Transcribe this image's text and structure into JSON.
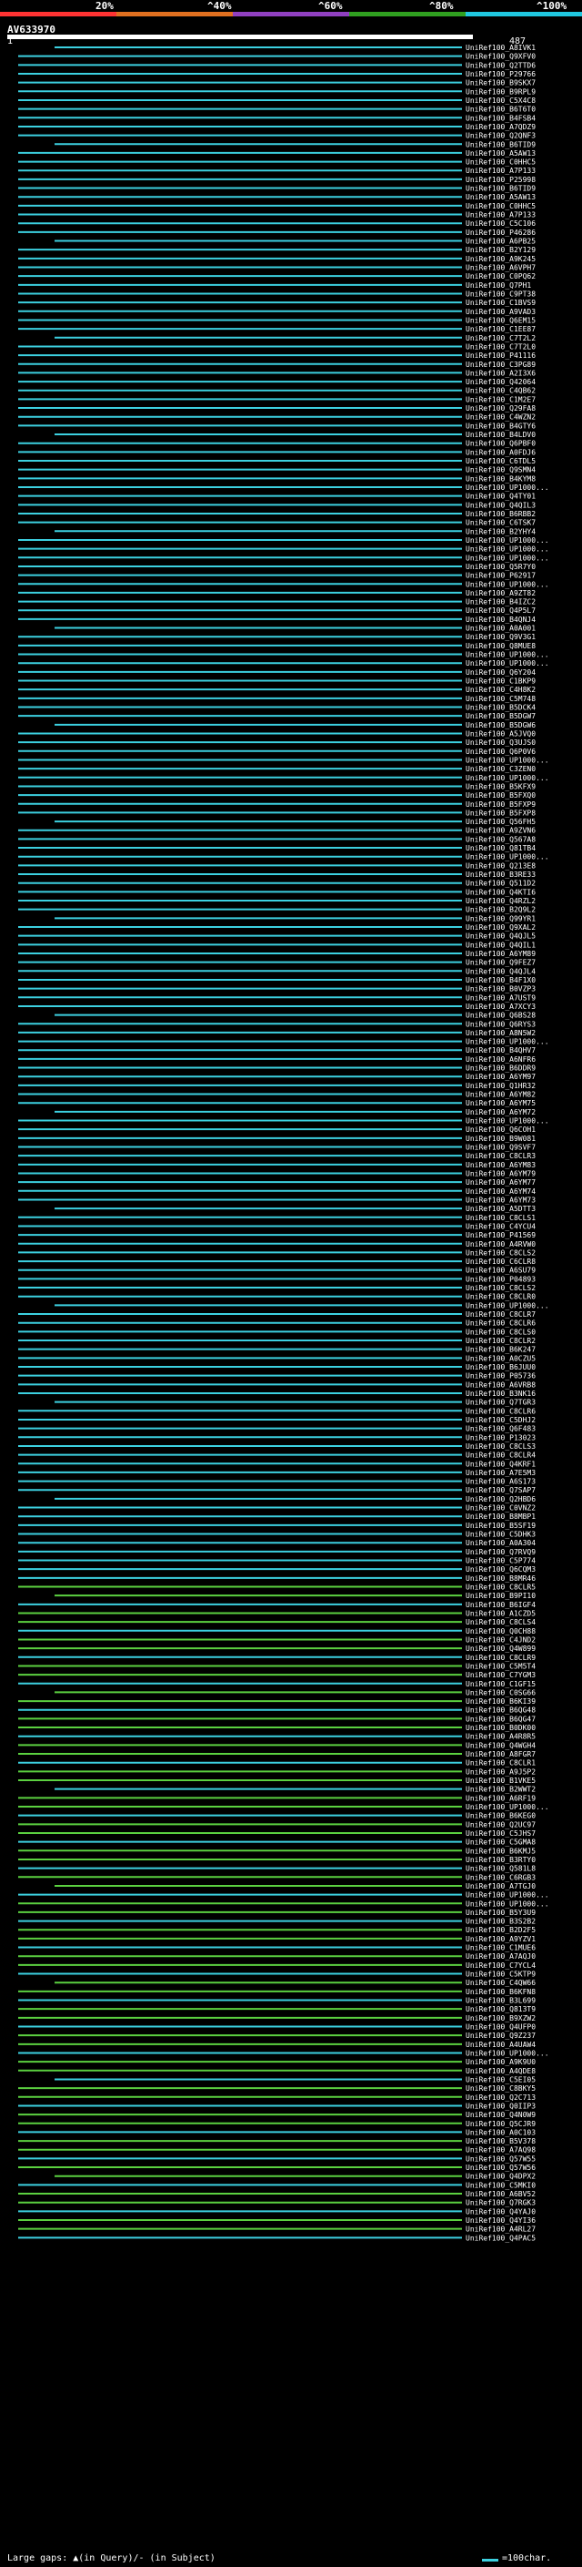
{
  "header": {
    "query_name": "AV633970",
    "start_label": "1",
    "end_label": "487"
  },
  "scale": {
    "ticks": [
      {
        "label": "20%",
        "color": "#ff3333"
      },
      {
        "label": "^40%",
        "color": "#e07020"
      },
      {
        "label": "^60%",
        "color": "#9040c0"
      },
      {
        "label": "^80%",
        "color": "#30a020"
      },
      {
        "label": "^100%",
        "color": "#20c8e0"
      }
    ]
  },
  "colors": {
    "cyan": "#3cd0e0",
    "green": "#5bd040",
    "query": "#ffffff"
  },
  "legend": {
    "left_text": "Large gaps: ▲(in Query)/- (in Subject)",
    "right_text": "=100char."
  },
  "hits": [
    "UniRef100_A8IVK1",
    "UniRef100_Q9XFV0",
    "UniRef100_Q2TTD6",
    "UniRef100_P29766",
    "UniRef100_B9SKX7",
    "UniRef100_B9RPL9",
    "UniRef100_C5X4C8",
    "UniRef100_B6T6T0",
    "UniRef100_B4FSB4",
    "UniRef100_A7QDZ9",
    "UniRef100_Q2QNF3",
    "UniRef100_B6TID9",
    "UniRef100_A5AW13",
    "UniRef100_C0HHC5",
    "UniRef100_A7P133",
    "UniRef100_P25998",
    "UniRef100_B6TID9",
    "UniRef100_A5AW13",
    "UniRef100_C0HHC5",
    "UniRef100_A7P133",
    "UniRef100_C5C106",
    "UniRef100_P46286",
    "UniRef100_A6PB25",
    "UniRef100_B2Y129",
    "UniRef100_A9K245",
    "UniRef100_A6VPH7",
    "UniRef100_C0PQ62",
    "UniRef100_Q7PH1",
    "UniRef100_C9PT38",
    "UniRef100_C1BVS9",
    "UniRef100_A9VAD3",
    "UniRef100_Q6EM15",
    "UniRef100_C1EE87",
    "UniRef100_C7T2L2",
    "UniRef100_C7T2L0",
    "UniRef100_P41116",
    "UniRef100_C3PG89",
    "UniRef100_A2I3X6",
    "UniRef100_Q42064",
    "UniRef100_C4QB62",
    "UniRef100_C1M2E7",
    "UniRef100_Q29FA8",
    "UniRef100_C4WZN2",
    "UniRef100_B4GTY6",
    "UniRef100_B4LDV0",
    "UniRef100_Q6PBF0",
    "UniRef100_A0FDJ6",
    "UniRef100_C6TDL5",
    "UniRef100_Q9SMN4",
    "UniRef100_B4KYM8",
    "UniRef100_UP1000...",
    "UniRef100_Q4TY01",
    "UniRef100_Q4QIL3",
    "UniRef100_B6RBB2",
    "UniRef100_C6TSK7",
    "UniRef100_B2YHY4",
    "UniRef100_UP1000...",
    "UniRef100_UP1000...",
    "UniRef100_UP1000...",
    "UniRef100_Q5R7Y0",
    "UniRef100_P62917",
    "UniRef100_UP1000...",
    "UniRef100_A9ZT82",
    "UniRef100_B4IZC2",
    "UniRef100_Q4P5L7",
    "UniRef100_B4QNJ4",
    "UniRef100_A0A001",
    "UniRef100_Q9V3G1",
    "UniRef100_Q8MUE8",
    "UniRef100_UP1000...",
    "UniRef100_UP1000...",
    "UniRef100_Q6Y204",
    "UniRef100_C1BKP9",
    "UniRef100_C4H8K2",
    "UniRef100_C5M748",
    "UniRef100_B5DCK4",
    "UniRef100_B5DGW7",
    "UniRef100_B5DGW6",
    "UniRef100_A5JVQ0",
    "UniRef100_Q3UJS0",
    "UniRef100_Q6P0V6",
    "UniRef100_UP1000...",
    "UniRef100_C3ZEN0",
    "UniRef100_UP1000...",
    "UniRef100_B5KFX9",
    "UniRef100_B5FXQ0",
    "UniRef100_B5FXP9",
    "UniRef100_B5FXP8",
    "UniRef100_Q56FH5",
    "UniRef100_A9ZVN6",
    "UniRef100_Q567A8",
    "UniRef100_Q81TB4",
    "UniRef100_UP1000...",
    "UniRef100_Q213E8",
    "UniRef100_B3RE33",
    "UniRef100_Q511D2",
    "UniRef100_Q4KTI6",
    "UniRef100_Q4RZL2",
    "UniRef100_B2Q9L2",
    "UniRef100_Q99YR1",
    "UniRef100_Q9XAL2",
    "UniRef100_Q4QJL5",
    "UniRef100_Q4QIL1",
    "UniRef100_A6YM89",
    "UniRef100_Q9FEZ7",
    "UniRef100_Q4QJL4",
    "UniRef100_B4F1X0",
    "UniRef100_B0VZP3",
    "UniRef100_A7UST9",
    "UniRef100_A7XCY3",
    "UniRef100_Q6BS28",
    "UniRef100_Q6RYS3",
    "UniRef100_A8N5W2",
    "UniRef100_UP1000...",
    "UniRef100_B4QHV7",
    "UniRef100_A6NFR6",
    "UniRef100_B6DDR9",
    "UniRef100_A6YM97",
    "UniRef100_Q1HR32",
    "UniRef100_A6YM82",
    "UniRef100_A6YM75",
    "UniRef100_A6YM72",
    "UniRef100_UP1000...",
    "UniRef100_Q6COH1",
    "UniRef100_B9W081",
    "UniRef100_Q9SVF7",
    "UniRef100_C8CLR3",
    "UniRef100_A6YM83",
    "UniRef100_A6YM79",
    "UniRef100_A6YM77",
    "UniRef100_A6YM74",
    "UniRef100_A6YM73",
    "UniRef100_A5DTT3",
    "UniRef100_C8CLS1",
    "UniRef100_C4YCU4",
    "UniRef100_P41569",
    "UniRef100_A4RVW0",
    "UniRef100_C8CLS2",
    "UniRef100_C6CLR8",
    "UniRef100_A6SU79",
    "UniRef100_P04893",
    "UniRef100_C8CLS2",
    "UniRef100_C8CLR0",
    "UniRef100_UP1000...",
    "UniRef100_C8CLR7",
    "UniRef100_C8CLR6",
    "UniRef100_C8CLS0",
    "UniRef100_C8CLR2",
    "UniRef100_B6K247",
    "UniRef100_A0CZU5",
    "UniRef100_B6JUU0",
    "UniRef100_P05736",
    "UniRef100_A6VRB8",
    "UniRef100_B3NK16",
    "UniRef100_Q7TGR3",
    "UniRef100_C8CLR6",
    "UniRef100_C5DHJ2",
    "UniRef100_Q6F483",
    "UniRef100_P13023",
    "UniRef100_C8CLS3",
    "UniRef100_C8CLR4",
    "UniRef100_Q4KRF1",
    "UniRef100_A7E5M3",
    "UniRef100_A6S173",
    "UniRef100_Q7SAP7",
    "UniRef100_Q2HBD6",
    "UniRef100_C0VNZ2",
    "UniRef100_B8MBP1",
    "UniRef100_B5SF19",
    "UniRef100_C5DHK3",
    "UniRef100_A0A304",
    "UniRef100_Q7RVQ9",
    "UniRef100_C5P774",
    "UniRef100_Q6CQM3",
    "UniRef100_B8MR46",
    "UniRef100_C8CLR5",
    "UniRef100_B9PI10",
    "UniRef100_B6IGF4",
    "UniRef100_A1CZD5",
    "UniRef100_C8CLS4",
    "UniRef100_Q0CH88",
    "UniRef100_C4JND2",
    "UniRef100_Q4W899",
    "UniRef100_C8CLR9",
    "UniRef100_C5M5T4",
    "UniRef100_C7YGM3",
    "UniRef100_C1GF15",
    "UniRef100_C0SG66",
    "UniRef100_B6KI39",
    "UniRef100_B6QG48",
    "UniRef100_B6QG47",
    "UniRef100_B0DK00",
    "UniRef100_A4R8R5",
    "UniRef100_Q4WGH4",
    "UniRef100_A8FGR7",
    "UniRef100_C8CLR1",
    "UniRef100_A9J5P2",
    "UniRef100_B1VKE5",
    "UniRef100_B2WWT2",
    "UniRef100_A6RF19",
    "UniRef100_UP1000...",
    "UniRef100_B6KEG0",
    "UniRef100_Q2UC97",
    "UniRef100_C5JHS7",
    "UniRef100_C5GMA8",
    "UniRef100_B6KMJ5",
    "UniRef100_B3RTY0",
    "UniRef100_Q581L8",
    "UniRef100_C6RGB3",
    "UniRef100_A7TGJ0",
    "UniRef100_UP1000...",
    "UniRef100_UP1000...",
    "UniRef100_B5Y3U9",
    "UniRef100_B3S2B2",
    "UniRef100_B2D2F5",
    "UniRef100_A9YZV1",
    "UniRef100_C1MUE6",
    "UniRef100_A7AQJ0",
    "UniRef100_C7YCL4",
    "UniRef100_C5KTP9",
    "UniRef100_C4QW66",
    "UniRef100_B6KFN8",
    "UniRef100_B3L699",
    "UniRef100_Q813T9",
    "UniRef100_B9XZW2",
    "UniRef100_Q4UFP0",
    "UniRef100_Q9Z237",
    "UniRef100_A4UAW4",
    "UniRef100_UP1000...",
    "UniRef100_A9K9U0",
    "UniRef100_A4QDE8",
    "UniRef100_C5EI05",
    "UniRef100_C8BKY5",
    "UniRef100_Q2C713",
    "UniRef100_Q0IIP3",
    "UniRef100_Q4N0W9",
    "UniRef100_Q5CJR9",
    "UniRef100_A0C103",
    "UniRef100_B5V378",
    "UniRef100_A7AQ98",
    "UniRef100_Q57W55",
    "UniRef100_Q57W56",
    "UniRef100_Q4DPX2",
    "UniRef100_C5MKI0",
    "UniRef100_A6BV52",
    "UniRef100_Q7RGK3",
    "UniRef100_Q4YAJ0",
    "UniRef100_Q4YI36",
    "UniRef100_A4RL27",
    "UniRef100_Q4PAC5"
  ]
}
